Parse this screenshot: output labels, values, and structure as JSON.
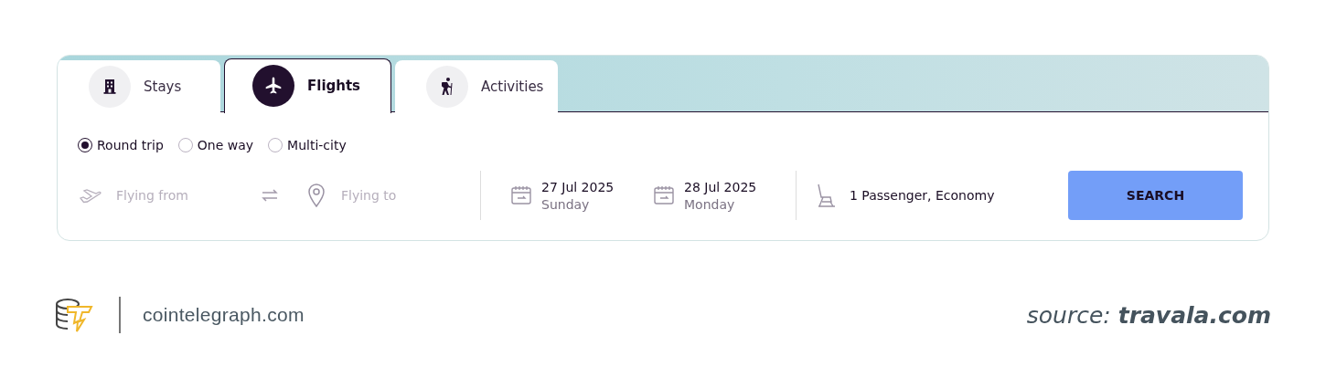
{
  "tabs": [
    {
      "label": "Stays",
      "kind": "building",
      "selected": false
    },
    {
      "label": "Flights",
      "kind": "plane",
      "selected": true
    },
    {
      "label": "Activities",
      "kind": "hiker",
      "selected": false
    }
  ],
  "trip_types": [
    {
      "label": "Round trip",
      "selected": true
    },
    {
      "label": "One way",
      "selected": false
    },
    {
      "label": "Multi-city",
      "selected": false
    }
  ],
  "origin": {
    "placeholder": "Flying from"
  },
  "destination": {
    "placeholder": "Flying to"
  },
  "dates": [
    {
      "date": "27 Jul 2025",
      "day": "Sunday"
    },
    {
      "date": "28 Jul 2025",
      "day": "Monday"
    }
  ],
  "travellers": "1 Passenger, Economy",
  "search_button": "SEARCH",
  "footer": {
    "site": "cointelegraph.com",
    "source": "source: **travala.com**"
  }
}
